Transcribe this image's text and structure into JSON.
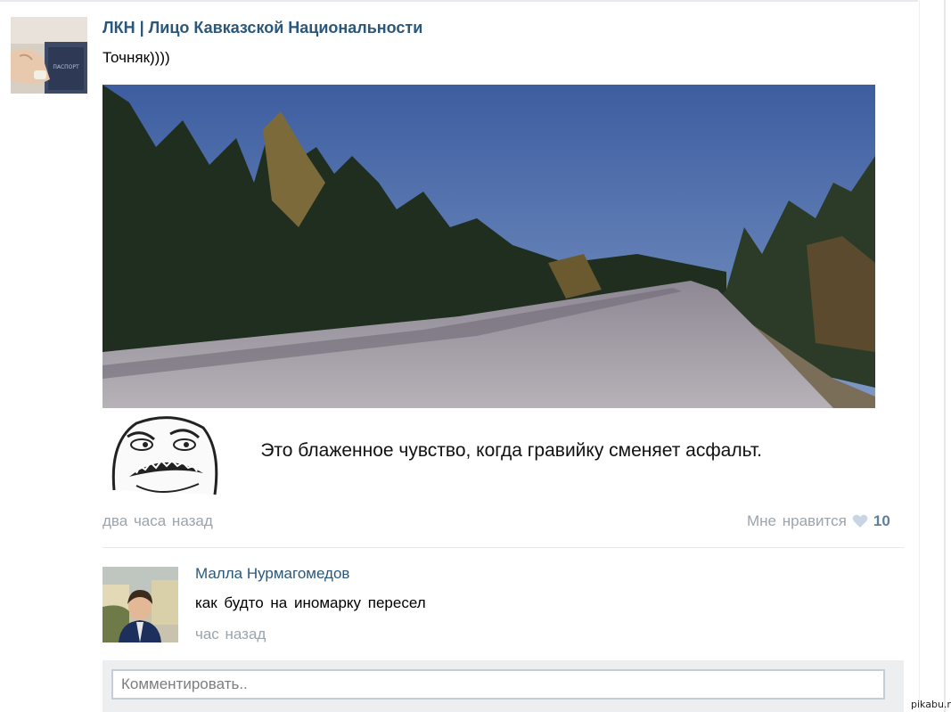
{
  "post": {
    "author": "ЛКН | Лицо Кавказской Национальности",
    "text": "Точняк))))",
    "image_caption": "Это блаженное чувство, когда гравийку сменяет асфальт.",
    "time": "два часа назад",
    "like_label": "Мне нравится",
    "like_icon": "heart-icon",
    "like_count": "10"
  },
  "comment": {
    "author": "Малла Нурмагомедов",
    "text": "как будто на иномарку пересел",
    "time": "час назад"
  },
  "reply": {
    "placeholder": "Комментировать.."
  },
  "watermark": "pikabu.ru",
  "colors": {
    "link": "#2b587a",
    "meta": "#9ba4ad",
    "like_count": "#5d7e9c",
    "reply_bg": "#edeef0"
  }
}
